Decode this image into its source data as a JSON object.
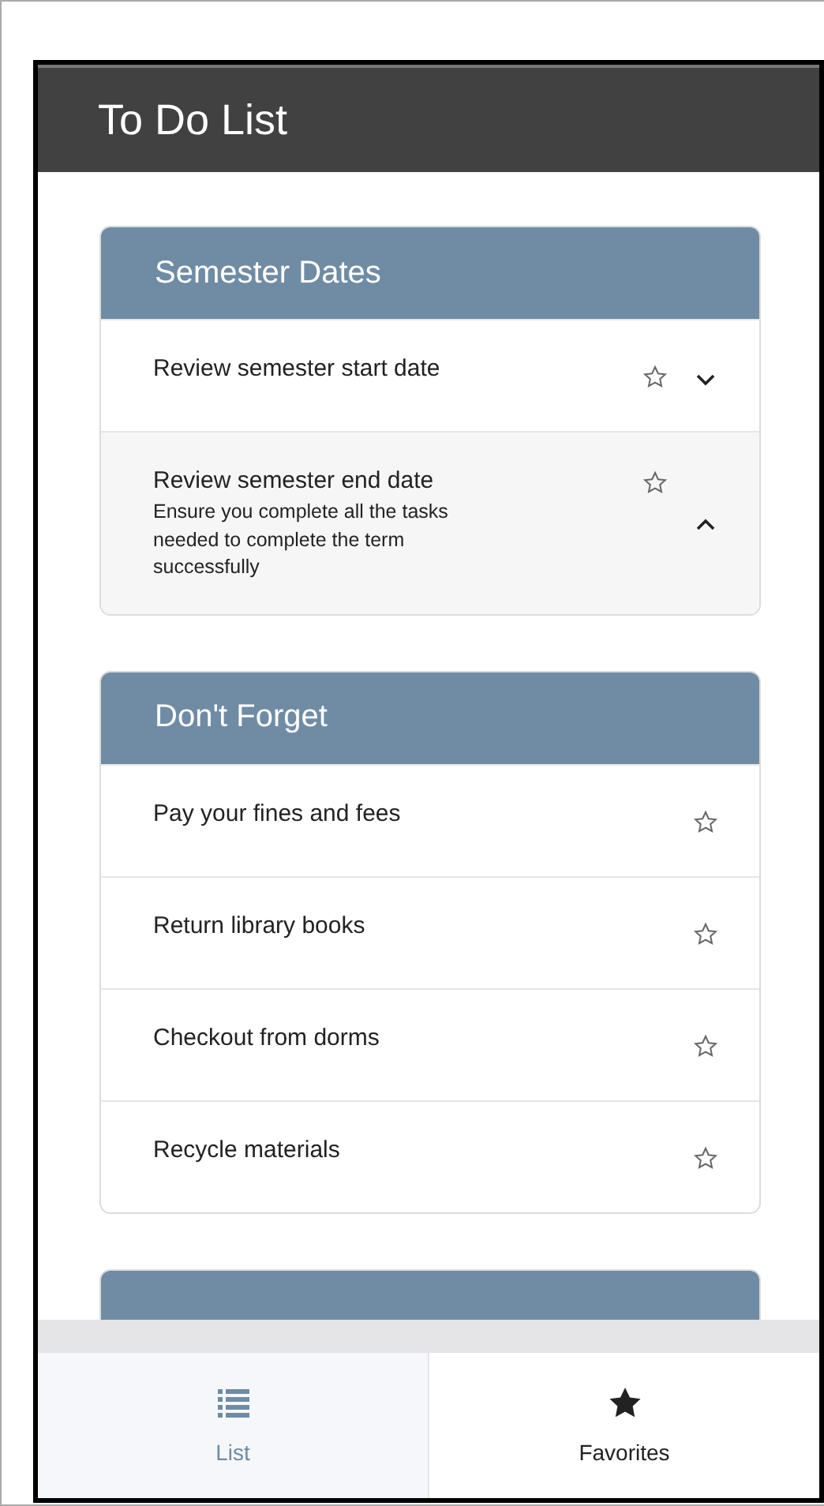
{
  "header": {
    "title": "To Do List"
  },
  "cards": [
    {
      "title": "Semester Dates",
      "items": [
        {
          "text": "Review semester start date",
          "favorite": false,
          "expanded": false
        },
        {
          "text": "Review semester end date",
          "description": "Ensure you complete all the tasks needed to complete the term successfully",
          "favorite": false,
          "expanded": true
        }
      ]
    },
    {
      "title": "Don't Forget",
      "items": [
        {
          "text": "Pay your fines and fees",
          "favorite": false
        },
        {
          "text": "Return library books",
          "favorite": false
        },
        {
          "text": "Checkout from dorms",
          "favorite": false
        },
        {
          "text": "Recycle materials",
          "favorite": false
        }
      ]
    },
    {
      "partial": true
    }
  ],
  "tabs": [
    {
      "label": "List",
      "kind": "list",
      "selected": true
    },
    {
      "label": "Favorites",
      "kind": "star",
      "selected": false
    }
  ]
}
